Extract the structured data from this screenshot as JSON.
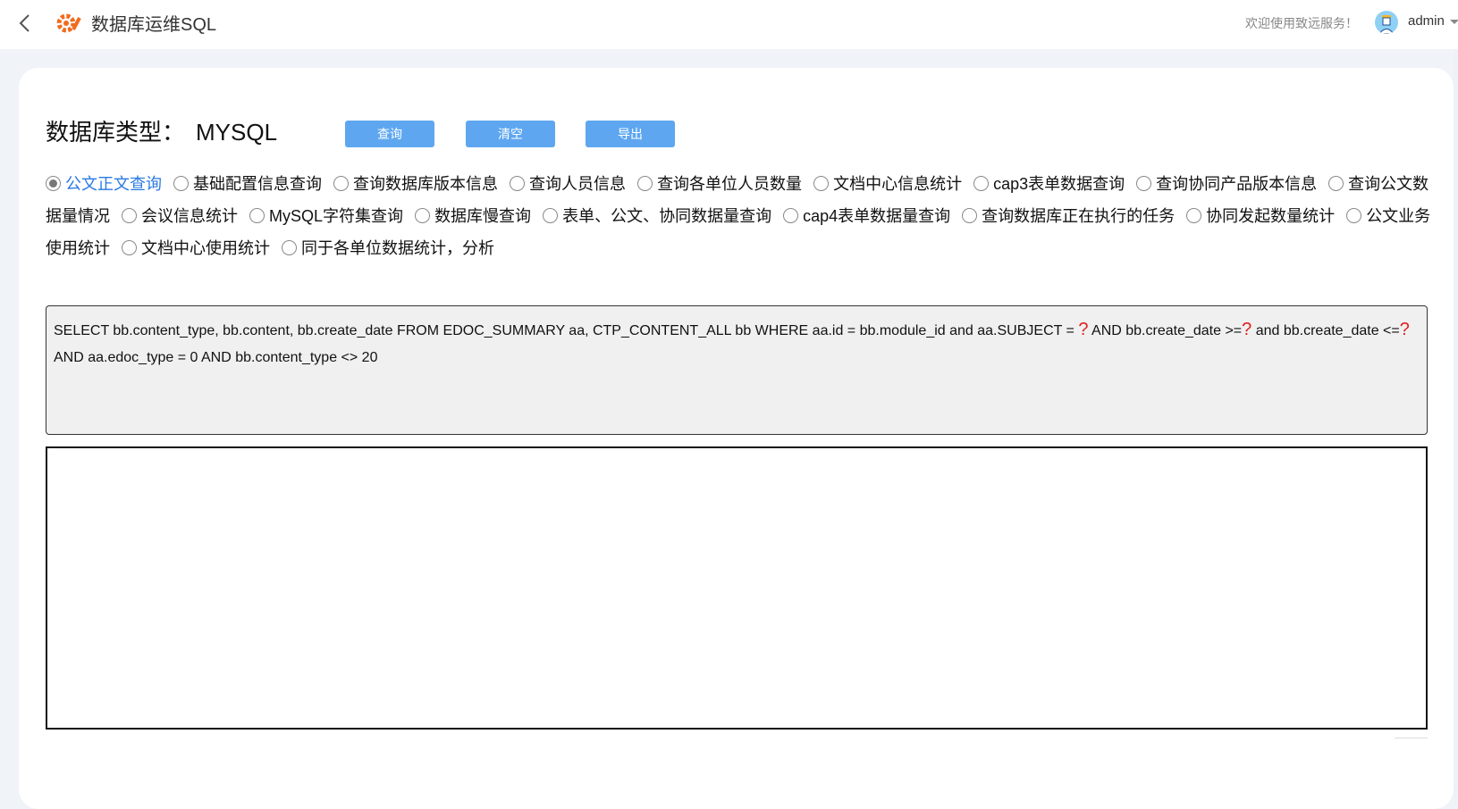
{
  "header": {
    "title": "数据库运维SQL",
    "welcome": "欢迎使用致远服务！",
    "user": "admin",
    "accent": "#f26b1d"
  },
  "main": {
    "db_label": "数据库类型：",
    "db_type": "MYSQL",
    "buttons": {
      "query": "查询",
      "clear": "清空",
      "export": "导出"
    },
    "options": [
      {
        "label": "公文正文查询",
        "checked": true
      },
      {
        "label": "基础配置信息查询"
      },
      {
        "label": "查询数据库版本信息"
      },
      {
        "label": "查询人员信息"
      },
      {
        "label": "查询各单位人员数量"
      },
      {
        "label": "文档中心信息统计"
      },
      {
        "label": "cap3表单数据查询"
      },
      {
        "label": "查询协同产品版本信息"
      },
      {
        "label": "查询公文数据量情况"
      },
      {
        "label": "会议信息统计"
      },
      {
        "label": "MySQL字符集查询"
      },
      {
        "label": "数据库慢查询"
      },
      {
        "label": "表单、公文、协同数据量查询"
      },
      {
        "label": "cap4表单数据量查询"
      },
      {
        "label": "查询数据库正在执行的任务"
      },
      {
        "label": "协同发起数量统计"
      },
      {
        "label": "公文业务使用统计"
      },
      {
        "label": "文档中心使用统计"
      },
      {
        "label": "同于各单位数据统计，分析"
      }
    ],
    "sql": {
      "part1": "SELECT bb.content_type, bb.content, bb.create_date FROM EDOC_SUMMARY aa, CTP_CONTENT_ALL bb WHERE aa.id = bb.module_id and aa.SUBJECT = ",
      "param1": "?",
      "part2": " AND bb.create_date >=",
      "param2": "?",
      "part3": " and bb.create_date <=",
      "param3": "?",
      "part4": " AND aa.edoc_type = 0 AND bb.content_type <> 20"
    }
  }
}
